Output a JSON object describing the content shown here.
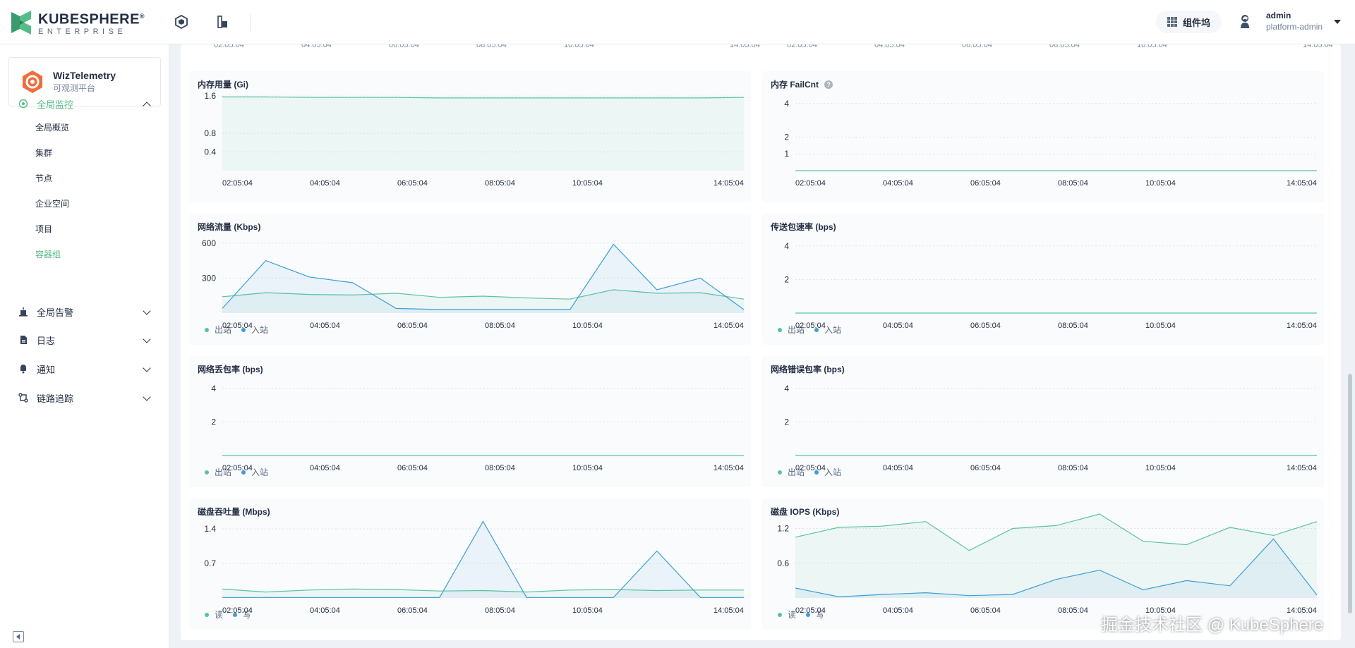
{
  "header": {
    "logo_title": "KUBESPHERE",
    "logo_registered": "®",
    "logo_sub": "ENTERPRISE",
    "widget_label": "组件坞",
    "user_name": "admin",
    "user_role": "platform-admin"
  },
  "sidebar": {
    "app_name": "WizTelemetry",
    "app_desc": "可观测平台",
    "groups": [
      {
        "label": "全局监控",
        "icon": "monitor-icon",
        "active": true
      },
      {
        "label": "全局告警",
        "icon": "alert-icon"
      },
      {
        "label": "日志",
        "icon": "log-icon"
      },
      {
        "label": "通知",
        "icon": "notification-icon"
      },
      {
        "label": "链路追踪",
        "icon": "tracing-icon"
      }
    ],
    "items": [
      "全局概览",
      "集群",
      "节点",
      "企业空间",
      "项目",
      "容器组"
    ],
    "active_item": "容器组"
  },
  "colors": {
    "accent": "#55bc8a",
    "series_a": "#5cc39b",
    "series_b": "#3d9fd3",
    "grid": "#dde3ea"
  },
  "times": [
    "02:05:04",
    "04:05:04",
    "06:05:04",
    "08:05:04",
    "10:05:04",
    "14:05:04"
  ],
  "watermark": "掘金技术社区 @ KubeSphere",
  "chart_data": [
    {
      "type": "area",
      "title": "内存用量 (Gi)",
      "yticks": [
        "1.6",
        "0.8",
        "0.4"
      ],
      "ylim": [
        0,
        1.8
      ],
      "series": [
        {
          "values": [
            1.58,
            1.58,
            1.57,
            1.57,
            1.57,
            1.56,
            1.56,
            1.56,
            1.56,
            1.56,
            1.56,
            1.56,
            1.57
          ]
        }
      ]
    },
    {
      "type": "line",
      "title": "内存 FailCnt",
      "help": "?",
      "yticks": [
        "4",
        "2",
        "1"
      ],
      "ylim": [
        0,
        5
      ],
      "series": [
        {
          "values": [
            0,
            0,
            0,
            0,
            0,
            0,
            0,
            0,
            0,
            0,
            0,
            0,
            0
          ]
        }
      ]
    },
    {
      "type": "area",
      "title": "网络流量 (Kbps)",
      "yticks": [
        "600",
        "300"
      ],
      "ylim": [
        0,
        720
      ],
      "legend": [
        "出站",
        "入站"
      ],
      "series": [
        {
          "name": "出站",
          "values": [
            140,
            175,
            160,
            155,
            170,
            135,
            145,
            130,
            120,
            200,
            170,
            175,
            120
          ]
        },
        {
          "name": "入站",
          "values": [
            40,
            450,
            310,
            260,
            40,
            30,
            30,
            30,
            30,
            590,
            200,
            300,
            30
          ]
        }
      ]
    },
    {
      "type": "line",
      "title": "传送包速率 (bps)",
      "yticks": [
        "4",
        "2"
      ],
      "ylim": [
        0,
        5
      ],
      "legend": [
        "出站",
        "入站"
      ],
      "series": [
        {
          "name": "出站",
          "values": [
            0,
            0,
            0,
            0,
            0,
            0,
            0,
            0,
            0,
            0,
            0,
            0,
            0
          ]
        }
      ]
    },
    {
      "type": "line",
      "title": "网络丢包率 (bps)",
      "yticks": [
        "4",
        "2"
      ],
      "ylim": [
        0,
        5
      ],
      "legend": [
        "出站",
        "入站"
      ],
      "series": [
        {
          "name": "出站",
          "values": [
            0,
            0,
            0,
            0,
            0,
            0,
            0,
            0,
            0,
            0,
            0,
            0,
            0
          ]
        }
      ]
    },
    {
      "type": "line",
      "title": "网络错误包率 (bps)",
      "yticks": [
        "4",
        "2"
      ],
      "ylim": [
        0,
        5
      ],
      "legend": [
        "出站",
        "入站"
      ],
      "series": [
        {
          "name": "出站",
          "values": [
            0,
            0,
            0,
            0,
            0,
            0,
            0,
            0,
            0,
            0,
            0,
            0,
            0
          ]
        }
      ]
    },
    {
      "type": "area",
      "title": "磁盘吞吐量 (Mbps)",
      "yticks": [
        "1.4",
        "0.7"
      ],
      "ylim": [
        0,
        1.7
      ],
      "legend": [
        "读",
        "写"
      ],
      "series": [
        {
          "name": "读",
          "values": [
            0.18,
            0.12,
            0.16,
            0.18,
            0.17,
            0.14,
            0.15,
            0.12,
            0.16,
            0.17,
            0.15,
            0.16,
            0.16
          ]
        },
        {
          "name": "写",
          "values": [
            0.01,
            0.01,
            0.01,
            0.01,
            0.01,
            0.01,
            1.55,
            0.01,
            0.01,
            0.01,
            0.95,
            0.01,
            0.01
          ]
        }
      ]
    },
    {
      "type": "area",
      "title": "磁盘 IOPS (Kbps)",
      "yticks": [
        "1.2",
        "0.6"
      ],
      "ylim": [
        0,
        1.45
      ],
      "legend": [
        "读",
        "写"
      ],
      "series": [
        {
          "name": "读",
          "values": [
            1.05,
            1.22,
            1.24,
            1.32,
            0.82,
            1.2,
            1.25,
            1.45,
            0.98,
            0.92,
            1.22,
            1.08,
            1.32
          ]
        },
        {
          "name": "写",
          "values": [
            0.17,
            0.02,
            0.06,
            0.09,
            0.04,
            0.06,
            0.32,
            0.48,
            0.14,
            0.3,
            0.21,
            1.02,
            0.05
          ]
        }
      ]
    }
  ]
}
